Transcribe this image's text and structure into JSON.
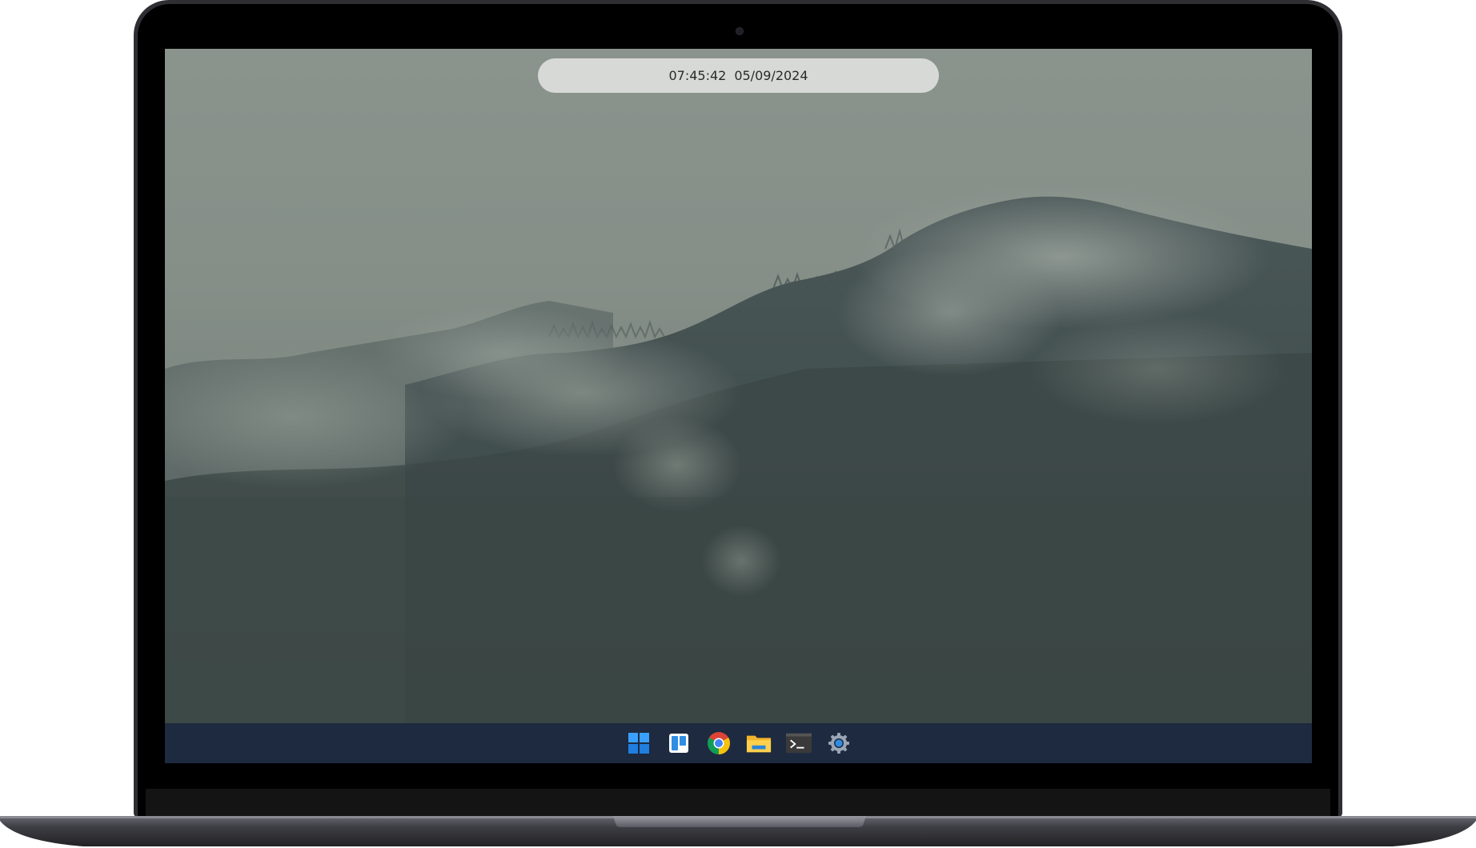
{
  "clock": {
    "time": "07:45:42",
    "date": "05/09/2024"
  },
  "taskbar": {
    "items": [
      {
        "name": "start",
        "icon": "windows-logo-icon"
      },
      {
        "name": "widgets",
        "icon": "widgets-icon"
      },
      {
        "name": "chrome",
        "icon": "chrome-icon"
      },
      {
        "name": "file-explorer",
        "icon": "folder-icon"
      },
      {
        "name": "terminal",
        "icon": "terminal-icon"
      },
      {
        "name": "settings",
        "icon": "gear-icon"
      }
    ]
  },
  "colors": {
    "taskbar_bg": "#1e2a3f",
    "clock_pill_bg": "#d7d9d7",
    "wallpaper_sky": "#8a948d",
    "wallpaper_forest": "#3e4a49",
    "laptop_body": "#2e2e33"
  }
}
